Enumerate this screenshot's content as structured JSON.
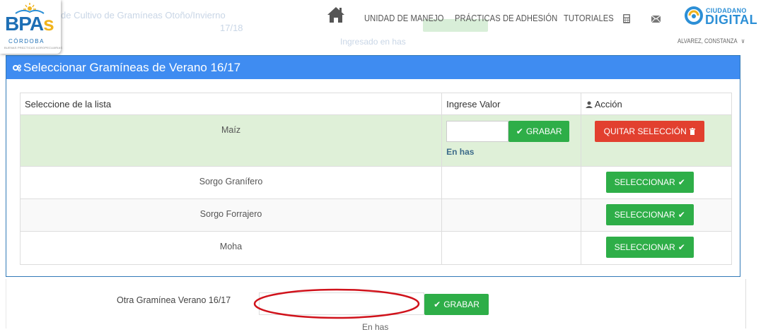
{
  "background": {
    "line1": "de Cultivo de Gramíneas Otoño/Invierno",
    "line2": "17/18",
    "line3": "Ingresado en has"
  },
  "header": {
    "nav": [
      "UNIDAD DE MANEJO",
      "PRÁCTICAS DE ADHESIÓN",
      "TUTORIALES"
    ],
    "brand_small": "CIUDADANO",
    "brand_big": "DIGITAL",
    "user": "ALVAREZ, CONSTANZA"
  },
  "logo": {
    "word_b": "B",
    "word_p": "P",
    "word_a": "A",
    "word_s": "s",
    "city": "CÓRDOBA",
    "tagline": "BUENAS PRÁCTICAS AGROPECUARIAS"
  },
  "panel": {
    "title": "Seleccionar Gramíneas de Verano 16/17"
  },
  "table": {
    "headers": [
      "Seleccione de la lista",
      "Ingrese Valor",
      "Acción"
    ],
    "rows": [
      {
        "name": "Maíz",
        "action": "QUITAR SELECCIÓN",
        "save": "GRABAR",
        "hint": "En has"
      },
      {
        "name": "Sorgo Granífero",
        "action": "SELECCIONAR"
      },
      {
        "name": "Sorgo Forrajero",
        "action": "SELECCIONAR"
      },
      {
        "name": "Moha",
        "action": "SELECCIONAR"
      }
    ]
  },
  "other": {
    "label": "Otra Gramínea Verano 16/17",
    "button": "GRABAR",
    "hint": "En has"
  },
  "colors": {
    "panel_header": "#3f8cf1",
    "green_button": "#2eae48",
    "red_button": "#e2402f",
    "selected_row": "#dff0d8",
    "annotation": "#d0121b"
  }
}
